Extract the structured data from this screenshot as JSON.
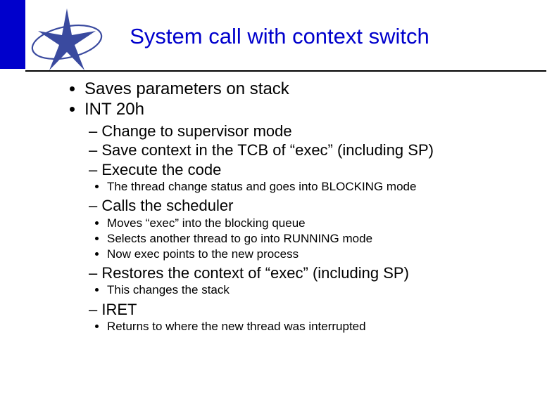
{
  "title": "System call with context switch",
  "bullets": {
    "l1_0": "Saves parameters on stack",
    "l1_1": "INT 20h",
    "l2_0": "Change to supervisor mode",
    "l2_1": "Save context in the TCB of “exec” (including SP)",
    "l2_2": "Execute the code",
    "l3_0": "The thread change status and goes into BLOCKING mode",
    "l2_3": "Calls the scheduler",
    "l3_1": "Moves “exec” into the blocking queue",
    "l3_2": "Selects another thread to go into RUNNING mode",
    "l3_3": "Now exec points to the new process",
    "l2_4": "Restores the context of “exec” (including SP)",
    "l3_4": "This changes the stack",
    "l2_5": "IRET",
    "l3_5": "Returns to where the new thread was interrupted"
  }
}
